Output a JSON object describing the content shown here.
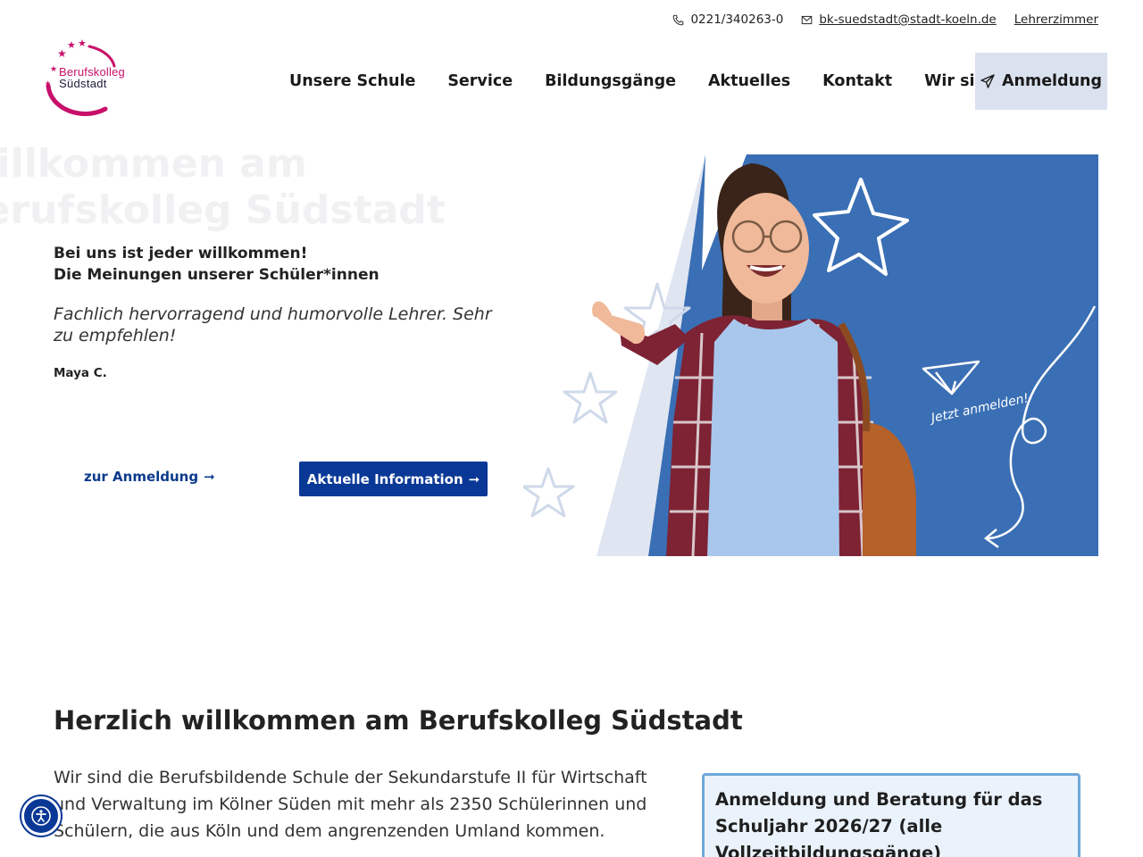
{
  "topbar": {
    "phone": "0221/340263-0",
    "email": "bk-suedstadt@stadt-koeln.de",
    "staff_link": "Lehrerzimmer"
  },
  "logo": {
    "line1": "Berufskolleg",
    "line2": "Südstadt",
    "colors": {
      "magenta": "#c8106a",
      "navy": "#1c1c3a"
    }
  },
  "nav": {
    "items": [
      "Unsere Schule",
      "Service",
      "Bildungsgänge",
      "Aktuelles",
      "Kontakt",
      "Wir sind Europa"
    ],
    "cta": "Anmeldung"
  },
  "hero": {
    "ghost_title_line1": "Willkommen am",
    "ghost_title_line2": "Berufskolleg Südstadt",
    "heading_line1": "Bei uns ist jeder willkommen!",
    "heading_line2": "Die Meinungen unserer Schüler*innen",
    "quote": "Fachlich hervorragend und humorvolle Lehrer. Sehr zu empfehlen!",
    "author": "Maya C.",
    "link_button": "zur Anmeldung",
    "primary_button": "Aktuelle Information",
    "image_caption": "Jetzt anmelden!"
  },
  "intro": {
    "title": "Herzlich willkommen am Berufskolleg Südstadt",
    "body": "Wir sind die Berufsbildende Schule der Sekundarstufe II für Wirtschaft und Verwaltung im Kölner Süden mit mehr als 2350 Schülerinnen und Schülern, die aus Köln und dem angrenzenden Umland kommen.",
    "infobox": "Anmeldung und Beratung für das Schuljahr 2026/27 (alle Vollzeitbildungsgänge)"
  },
  "colors": {
    "primary": "#0a3896",
    "hero_blue": "#3a6fb5",
    "nav_cta_bg": "#dbe2ef",
    "infobox_border": "#6fa8d8"
  }
}
